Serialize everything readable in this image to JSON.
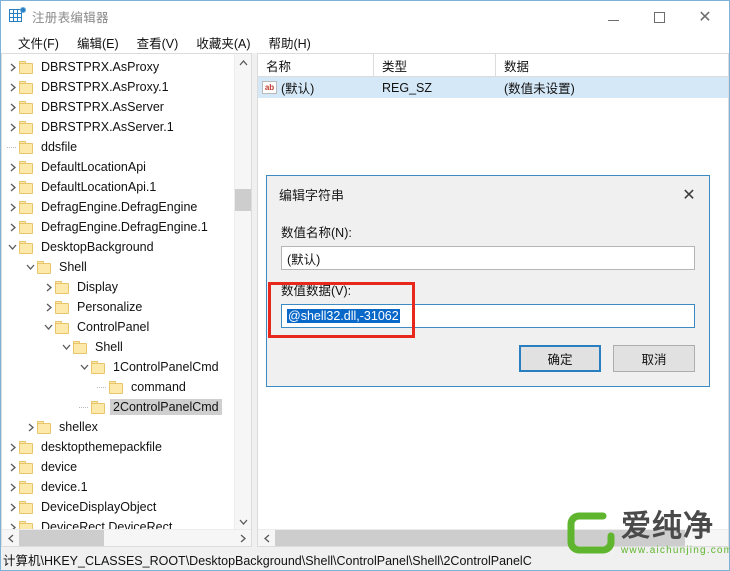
{
  "window": {
    "title": "注册表编辑器",
    "icon": "registry-icon",
    "controls": {
      "minimize": "–",
      "maximize": "□",
      "close": "✕"
    }
  },
  "menubar": {
    "items": [
      {
        "label": "文件(F)"
      },
      {
        "label": "编辑(E)"
      },
      {
        "label": "查看(V)"
      },
      {
        "label": "收藏夹(A)"
      },
      {
        "label": "帮助(H)"
      }
    ]
  },
  "tree": {
    "nodes": [
      {
        "label": "DBRSTPRX.AsProxy",
        "depth": 0,
        "twist": "collapsed",
        "selected": false
      },
      {
        "label": "DBRSTPRX.AsProxy.1",
        "depth": 0,
        "twist": "collapsed",
        "selected": false
      },
      {
        "label": "DBRSTPRX.AsServer",
        "depth": 0,
        "twist": "collapsed",
        "selected": false
      },
      {
        "label": "DBRSTPRX.AsServer.1",
        "depth": 0,
        "twist": "collapsed",
        "selected": false
      },
      {
        "label": "ddsfile",
        "depth": 0,
        "twist": "none",
        "selected": false
      },
      {
        "label": "DefaultLocationApi",
        "depth": 0,
        "twist": "collapsed",
        "selected": false
      },
      {
        "label": "DefaultLocationApi.1",
        "depth": 0,
        "twist": "collapsed",
        "selected": false
      },
      {
        "label": "DefragEngine.DefragEngine",
        "depth": 0,
        "twist": "collapsed",
        "selected": false
      },
      {
        "label": "DefragEngine.DefragEngine.1",
        "depth": 0,
        "twist": "collapsed",
        "selected": false
      },
      {
        "label": "DesktopBackground",
        "depth": 0,
        "twist": "expanded",
        "selected": false
      },
      {
        "label": "Shell",
        "depth": 1,
        "twist": "expanded",
        "selected": false
      },
      {
        "label": "Display",
        "depth": 2,
        "twist": "collapsed",
        "selected": false
      },
      {
        "label": "Personalize",
        "depth": 2,
        "twist": "collapsed",
        "selected": false
      },
      {
        "label": "ControlPanel",
        "depth": 2,
        "twist": "expanded",
        "selected": false
      },
      {
        "label": "Shell",
        "depth": 3,
        "twist": "expanded",
        "selected": false
      },
      {
        "label": "1ControlPanelCmd",
        "depth": 4,
        "twist": "expanded",
        "selected": false
      },
      {
        "label": "command",
        "depth": 5,
        "twist": "none",
        "selected": false
      },
      {
        "label": "2ControlPanelCmd",
        "depth": 4,
        "twist": "none",
        "selected": true
      },
      {
        "label": "shellex",
        "depth": 1,
        "twist": "collapsed",
        "selected": false
      },
      {
        "label": "desktopthemepackfile",
        "depth": 0,
        "twist": "collapsed",
        "selected": false
      },
      {
        "label": "device",
        "depth": 0,
        "twist": "collapsed",
        "selected": false
      },
      {
        "label": "device.1",
        "depth": 0,
        "twist": "collapsed",
        "selected": false
      },
      {
        "label": "DeviceDisplayObject",
        "depth": 0,
        "twist": "collapsed",
        "selected": false
      },
      {
        "label": "DeviceRect.DeviceRect",
        "depth": 0,
        "twist": "collapsed",
        "selected": false
      }
    ]
  },
  "list": {
    "columns": [
      {
        "label": "名称"
      },
      {
        "label": "类型"
      },
      {
        "label": "数据"
      }
    ],
    "rows": [
      {
        "name": "(默认)",
        "type": "REG_SZ",
        "data": "(数值未设置)",
        "icon": "ab-string-icon",
        "selected": true
      }
    ]
  },
  "dialog": {
    "title": "编辑字符串",
    "close": "✕",
    "name_label": "数值名称(N):",
    "name_value": "(默认)",
    "data_label": "数值数据(V):",
    "data_value": "@shell32.dll,-31062",
    "ok_label": "确定",
    "cancel_label": "取消",
    "highlight_color": "#e8271d"
  },
  "statusbar": {
    "path": "计算机\\HKEY_CLASSES_ROOT\\DesktopBackground\\Shell\\ControlPanel\\Shell\\2ControlPanelC"
  },
  "watermark": {
    "name": "爱纯净",
    "url": "www.aichunjing.com",
    "color": "#5fb52e"
  }
}
